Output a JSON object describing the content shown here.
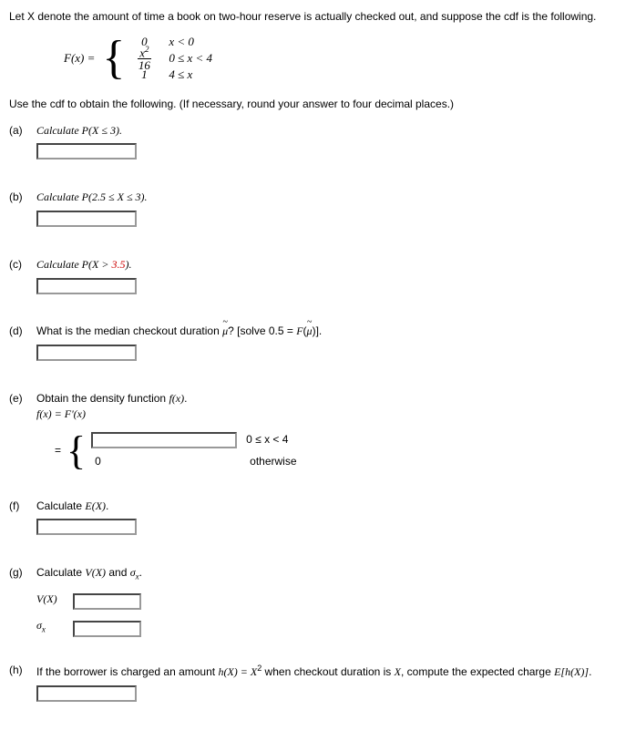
{
  "intro": "Let X denote the amount of time a book on two-hour reserve is actually checked out, and suppose the cdf is the following.",
  "cdf": {
    "label": "F(x) =",
    "rows": [
      {
        "val": "0",
        "cond": "x < 0"
      },
      {
        "val_num": "x",
        "val_den": "16",
        "cond": "0 ≤ x < 4"
      },
      {
        "val": "1",
        "cond": "4 ≤ x"
      }
    ]
  },
  "instruction": "Use the cdf to obtain the following. (If necessary, round your answer to four decimal places.)",
  "questions": {
    "a": {
      "label": "(a)",
      "text": "Calculate P(X ≤ 3)."
    },
    "b": {
      "label": "(b)",
      "text": "Calculate P(2.5 ≤ X ≤ 3)."
    },
    "c": {
      "label": "(c)",
      "text_pre": "Calculate P(X > ",
      "red": "3.5",
      "text_post": ")."
    },
    "d": {
      "label": "(d)",
      "text": "What is the median checkout duration μ̃? [solve 0.5 = F(μ̃)]."
    },
    "e": {
      "label": "(e)",
      "text": "Obtain the density function f(x).",
      "sub": "f(x) = F'(x)",
      "cond1": "0 ≤ x < 4",
      "cond2": "otherwise",
      "zero": "0"
    },
    "f": {
      "label": "(f)",
      "text": "Calculate E(X)."
    },
    "g": {
      "label": "(g)",
      "text": "Calculate V(X) and σ",
      "vx": "V(X)",
      "sigma": "σ"
    },
    "h": {
      "label": "(h)",
      "text_pre": "If the borrower is charged an amount ",
      "hx": "h(X) = X",
      "text_post": " when checkout duration is X, compute the expected charge E[h(X)]."
    }
  }
}
